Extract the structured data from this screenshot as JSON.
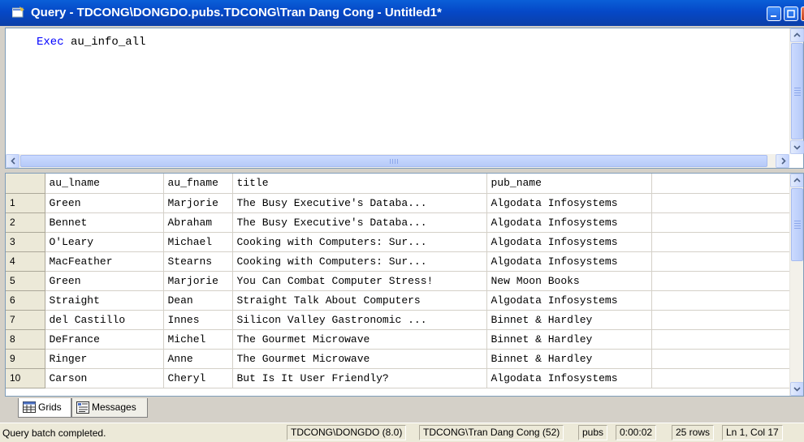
{
  "window": {
    "title": "Query - TDCONG\\DONGDO.pubs.TDCONG\\Tran Dang Cong - Untitled1*"
  },
  "editor": {
    "keyword": "Exec",
    "text": " au_info_all"
  },
  "results": {
    "columns": [
      "au_lname",
      "au_fname",
      "title",
      "pub_name"
    ],
    "rows": [
      {
        "num": "1",
        "cells": [
          "Green",
          "Marjorie",
          "The Busy Executive's Databa...",
          "Algodata Infosystems"
        ]
      },
      {
        "num": "2",
        "cells": [
          "Bennet",
          "Abraham",
          "The Busy Executive's Databa...",
          "Algodata Infosystems"
        ]
      },
      {
        "num": "3",
        "cells": [
          "O'Leary",
          "Michael",
          "Cooking with Computers: Sur...",
          "Algodata Infosystems"
        ]
      },
      {
        "num": "4",
        "cells": [
          "MacFeather",
          "Stearns",
          "Cooking with Computers: Sur...",
          "Algodata Infosystems"
        ]
      },
      {
        "num": "5",
        "cells": [
          "Green",
          "Marjorie",
          "You Can Combat Computer Stress!",
          "New Moon Books"
        ]
      },
      {
        "num": "6",
        "cells": [
          "Straight",
          "Dean",
          "Straight Talk About Computers",
          "Algodata Infosystems"
        ]
      },
      {
        "num": "7",
        "cells": [
          "del Castillo",
          "Innes",
          "Silicon Valley Gastronomic ...",
          "Binnet & Hardley"
        ]
      },
      {
        "num": "8",
        "cells": [
          "DeFrance",
          "Michel",
          "The Gourmet Microwave",
          "Binnet & Hardley"
        ]
      },
      {
        "num": "9",
        "cells": [
          "Ringer",
          "Anne",
          "The Gourmet Microwave",
          "Binnet & Hardley"
        ]
      },
      {
        "num": "10",
        "cells": [
          "Carson",
          "Cheryl",
          "But Is It User Friendly?",
          "Algodata Infosystems"
        ]
      }
    ]
  },
  "tabs": [
    {
      "label": "Grids",
      "icon": "grid-icon"
    },
    {
      "label": "Messages",
      "icon": "messages-icon"
    }
  ],
  "status": {
    "message": "Query batch completed.",
    "server": "TDCONG\\DONGDO (8.0)",
    "user": "TDCONG\\Tran Dang Cong (52)",
    "database": "pubs",
    "elapsed": "0:00:02",
    "rows": "25 rows",
    "position": "Ln 1, Col 17"
  },
  "colors": {
    "titlebar": "#0548c7",
    "keyword": "#0000ff",
    "row_header": "#ece9d8"
  }
}
